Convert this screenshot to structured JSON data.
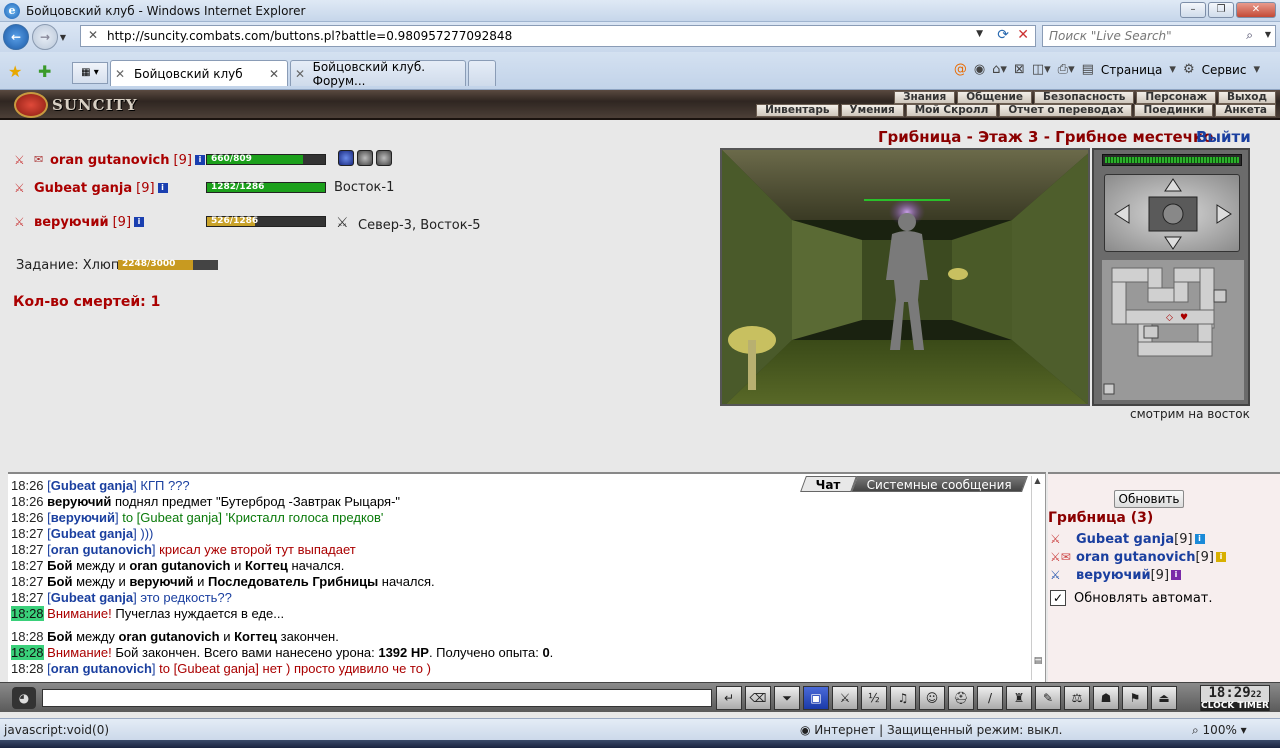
{
  "window": {
    "title": "Бойцовский клуб - Windows Internet Explorer"
  },
  "address": {
    "url": "http://suncity.combats.com/buttons.pl?battle=0.980957277092848",
    "search_placeholder": "Поиск \"Live Search\""
  },
  "tabs": [
    {
      "label": "Бойцовский клуб"
    },
    {
      "label": "Бойцовский клуб. Форум..."
    }
  ],
  "toolbar": {
    "page_label": "Страница",
    "service_label": "Сервис"
  },
  "game": {
    "logo": "SUNCITY",
    "menu_row1": [
      "Знания",
      "Общение",
      "Безопасность",
      "Персонаж",
      "Выход"
    ],
    "menu_row2": [
      "Инвентарь",
      "Умения",
      "Мой Скролл",
      "Отчет о переводах",
      "Поединки",
      "Анкета"
    ],
    "party": [
      {
        "name": "oran gutanovich",
        "level": "[9]",
        "hp": "660/809",
        "hp_fraction": 0.816
      },
      {
        "name": "Gubeat ganja",
        "level": "[9]",
        "hp": "1282/1286",
        "hp_fraction": 0.997,
        "location": "Восток-1"
      },
      {
        "name": "веруючий",
        "level": "[9]",
        "hp": "526/1286",
        "hp_fraction": 0.409,
        "location": "Север-3, Восток-5"
      }
    ],
    "task": {
      "label": "Задание: Хлюп",
      "progress": "2248/3000",
      "fraction": 0.749
    },
    "deaths": "Кол-во смертей: 1",
    "location_title": "Грибница - Этаж 3 - Грибное местечко",
    "exit": "Выйти",
    "looking": "смотрим на восток"
  },
  "chat": {
    "tabs": [
      "Чат",
      "Системные сообщения"
    ],
    "lines": [
      {
        "t": "18:26",
        "parts": [
          {
            "c": "br",
            "v": "["
          },
          {
            "c": "nm",
            "v": "Gubeat ganja"
          },
          {
            "c": "br",
            "v": "] КГП ???"
          }
        ]
      },
      {
        "t": "18:26",
        "parts": [
          {
            "c": "b",
            "v": "веруючий"
          },
          {
            "c": "",
            "v": " поднял предмет \"Бутерброд -Завтрак Рыцаря-\""
          }
        ]
      },
      {
        "t": "18:26",
        "parts": [
          {
            "c": "br",
            "v": "["
          },
          {
            "c": "nm",
            "v": "веруючий"
          },
          {
            "c": "br",
            "v": "] "
          },
          {
            "c": "g",
            "v": "to [Gubeat ganja] 'Кристалл голоса предков'"
          }
        ]
      },
      {
        "t": "18:27",
        "parts": [
          {
            "c": "br",
            "v": "["
          },
          {
            "c": "nm",
            "v": "Gubeat ganja"
          },
          {
            "c": "br",
            "v": "] )))"
          }
        ]
      },
      {
        "t": "18:27",
        "parts": [
          {
            "c": "br",
            "v": "["
          },
          {
            "c": "nm",
            "v": "oran gutanovich"
          },
          {
            "c": "br",
            "v": "] "
          },
          {
            "c": "r",
            "v": "крисал уже второй тут выпадает"
          }
        ]
      },
      {
        "t": "18:27",
        "parts": [
          {
            "c": "b",
            "v": "Бой"
          },
          {
            "c": "",
            "v": " между и "
          },
          {
            "c": "b",
            "v": "oran gutanovich"
          },
          {
            "c": "",
            "v": " и "
          },
          {
            "c": "b",
            "v": "Когтец"
          },
          {
            "c": "",
            "v": " начался."
          }
        ]
      },
      {
        "t": "18:27",
        "parts": [
          {
            "c": "b",
            "v": "Бой"
          },
          {
            "c": "",
            "v": " между и "
          },
          {
            "c": "b",
            "v": "веруючий"
          },
          {
            "c": "",
            "v": " и "
          },
          {
            "c": "b",
            "v": "Последователь Грибницы"
          },
          {
            "c": "",
            "v": " начался."
          }
        ]
      },
      {
        "t": "18:27",
        "parts": [
          {
            "c": "br",
            "v": "["
          },
          {
            "c": "nm",
            "v": "Gubeat ganja"
          },
          {
            "c": "br",
            "v": "] это редкость??"
          }
        ]
      },
      {
        "t": "18:28",
        "hl": true,
        "parts": [
          {
            "c": "r",
            "v": "Внимание!"
          },
          {
            "c": "",
            "v": " Пучеглаз нуждается в еде..."
          }
        ]
      },
      {
        "t": "18:28",
        "parts": [
          {
            "c": "b",
            "v": "Бой"
          },
          {
            "c": "",
            "v": " между "
          },
          {
            "c": "b",
            "v": "oran gutanovich"
          },
          {
            "c": "",
            "v": "   и "
          },
          {
            "c": "b",
            "v": "Когтец"
          },
          {
            "c": "",
            "v": " закончен."
          }
        ]
      },
      {
        "t": "18:28",
        "hl": true,
        "parts": [
          {
            "c": "r",
            "v": "Внимание!"
          },
          {
            "c": "",
            "v": " Бой закончен. Всего вами нанесено урона: "
          },
          {
            "c": "b",
            "v": "1392 HP"
          },
          {
            "c": "",
            "v": ". Получено опыта: "
          },
          {
            "c": "b",
            "v": "0"
          },
          {
            "c": "",
            "v": "."
          }
        ]
      },
      {
        "t": "18:28",
        "parts": [
          {
            "c": "br",
            "v": "["
          },
          {
            "c": "nm",
            "v": "oran gutanovich"
          },
          {
            "c": "br",
            "v": "] "
          },
          {
            "c": "r",
            "v": "to [Gubeat ganja] нет ) просто удивило че то )"
          }
        ]
      }
    ]
  },
  "sidebar": {
    "refresh": "Обновить",
    "room": "Грибница (3)",
    "users": [
      {
        "name": "Gubeat ganja",
        "level": "[9]"
      },
      {
        "name": "oran gutanovich",
        "level": "[9]"
      },
      {
        "name": "веруючий",
        "level": "[9]"
      }
    ],
    "auto_refresh": "Обновлять автомат."
  },
  "clock": {
    "time": "18:29",
    "seconds": "22",
    "label": "CLOCK TIMER"
  },
  "status": {
    "left": "javascript:void(0)",
    "zone": "Интернет | Защищенный режим: выкл.",
    "zoom": "100%"
  }
}
